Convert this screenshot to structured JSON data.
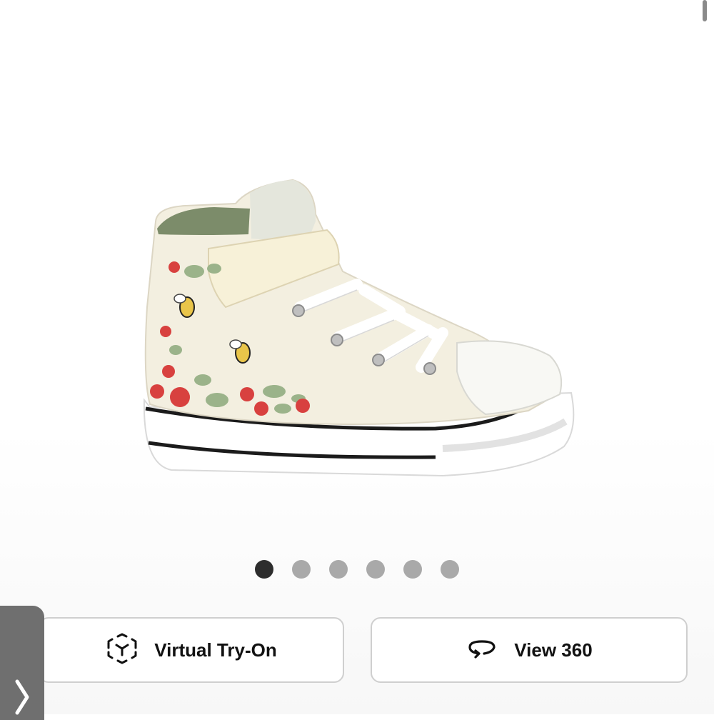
{
  "product": {
    "image_alt": "Toddler high-top sneaker with strawberry and bee embroidery"
  },
  "carousel": {
    "total": 6,
    "active_index": 0
  },
  "actions": {
    "try_on_label": "Virtual Try-On",
    "view360_label": "View 360"
  },
  "icons": {
    "try_on": "ar-cube-icon",
    "view360": "rotate-360-icon",
    "side_tab": "chevron-right-icon"
  },
  "colors": {
    "active_dot": "#2d2d2d",
    "inactive_dot": "#a9a9a9",
    "button_border": "#cfcfcf",
    "side_tab": "#6f6f6f"
  }
}
